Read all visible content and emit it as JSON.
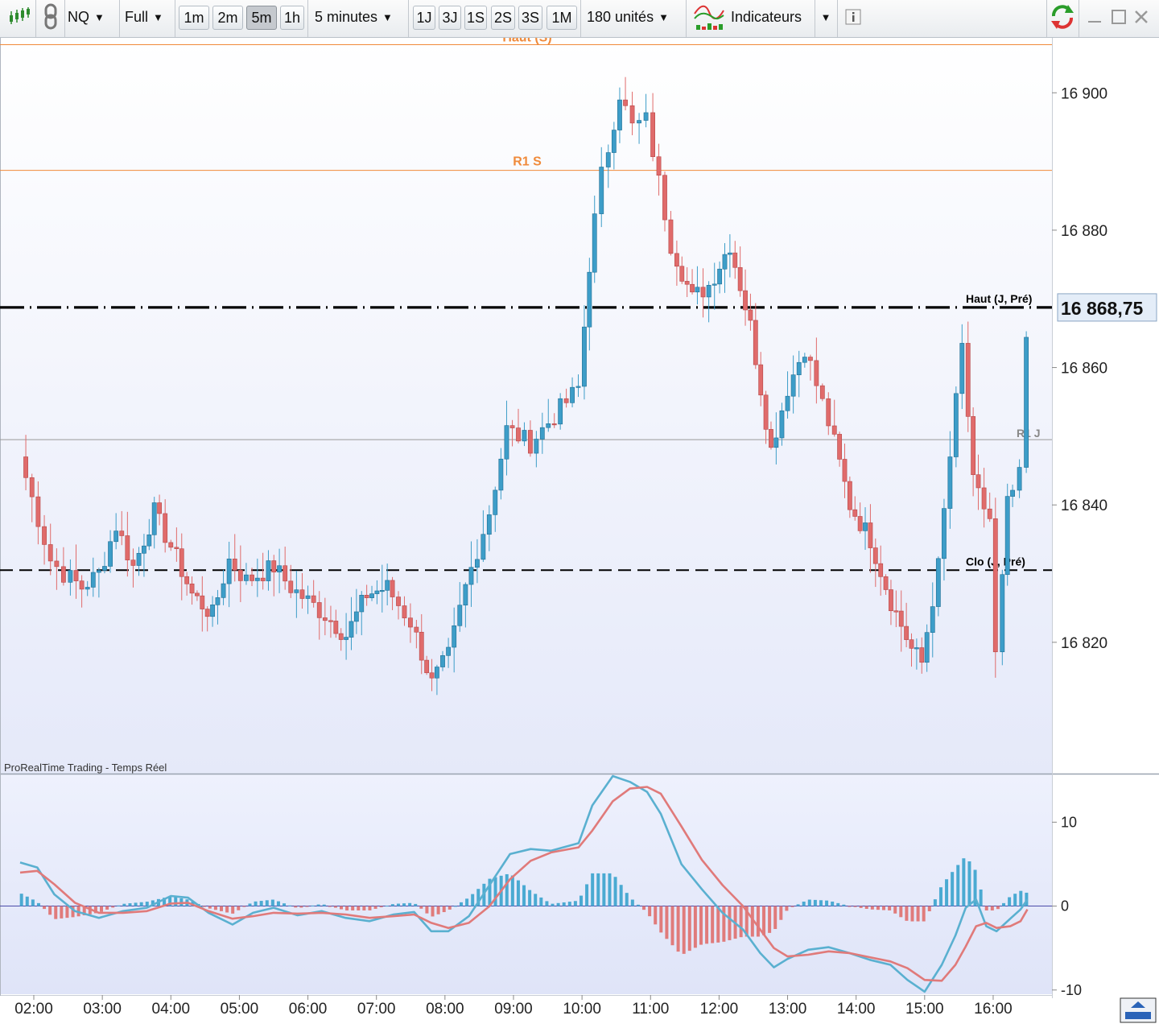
{
  "toolbar": {
    "symbol": "NQ",
    "mode": "Full",
    "timeframe_buttons": [
      "1m",
      "2m",
      "5m",
      "1h"
    ],
    "active_timeframe": "5m",
    "interval": "5 minutes",
    "range_buttons": [
      "1J",
      "3J",
      "1S",
      "2S",
      "3S",
      "1M"
    ],
    "units": "180 unités",
    "indicators": "Indicateurs"
  },
  "chart_data": [
    {
      "type": "candlestick",
      "watermark": "ProRealTime Trading - Temps Réel",
      "ylim": [
        16801,
        16908
      ],
      "y_ticks": [
        16820,
        16840,
        16860,
        16880,
        16900
      ],
      "y_tick_labels": [
        "16 820",
        "16 840",
        "16 860",
        "16 880",
        "16 900"
      ],
      "x_ticks": [
        2,
        3,
        4,
        5,
        6,
        7,
        8,
        9,
        10,
        11,
        12,
        13,
        14,
        15,
        16
      ],
      "x_tick_labels": [
        "02:00",
        "03:00",
        "04:00",
        "05:00",
        "06:00",
        "07:00",
        "08:00",
        "09:00",
        "10:00",
        "11:00",
        "12:00",
        "13:00",
        "14:00",
        "15:00",
        "16:00"
      ],
      "current_price": 16868.75,
      "current_price_label": "16 868,75",
      "levels": [
        {
          "label": "Haut (S)",
          "value": 16907,
          "color": "#f08a3a",
          "style": "solid"
        },
        {
          "label": "R1 S",
          "value": 16888.7,
          "color": "#f08a3a",
          "style": "solid"
        },
        {
          "label": "Haut (J, Pré)",
          "value": 16868.75,
          "color": "#000000",
          "style": "dashdot"
        },
        {
          "label": "R1 J",
          "value": 16849.5,
          "color": "#999999",
          "style": "solid"
        },
        {
          "label": "Clo (J, Pré)",
          "value": 16830.5,
          "color": "#000000",
          "style": "dashed"
        }
      ],
      "up_color": "#3d9dc8",
      "down_color": "#e06b6b",
      "path": [
        [
          1.8,
          16847
        ],
        [
          2.25,
          16832
        ],
        [
          2.45,
          16830
        ],
        [
          2.7,
          16828
        ],
        [
          2.95,
          16830
        ],
        [
          3.2,
          16837
        ],
        [
          3.45,
          16831
        ],
        [
          3.75,
          16839
        ],
        [
          4.0,
          16834
        ],
        [
          4.3,
          16827
        ],
        [
          4.6,
          16824
        ],
        [
          4.85,
          16832
        ],
        [
          5.1,
          16829
        ],
        [
          5.5,
          16831
        ],
        [
          5.75,
          16828
        ],
        [
          6.25,
          16824
        ],
        [
          6.55,
          16821
        ],
        [
          6.85,
          16827
        ],
        [
          7.15,
          16828
        ],
        [
          7.5,
          16823
        ],
        [
          7.8,
          16814
        ],
        [
          8.05,
          16818
        ],
        [
          8.3,
          16828
        ],
        [
          8.65,
          16839
        ],
        [
          8.9,
          16851
        ],
        [
          9.25,
          16849
        ],
        [
          9.6,
          16853
        ],
        [
          9.95,
          16857
        ],
        [
          10.1,
          16875
        ],
        [
          10.3,
          16888
        ],
        [
          10.55,
          16900
        ],
        [
          10.75,
          16895
        ],
        [
          10.95,
          16896
        ],
        [
          11.3,
          16878
        ],
        [
          11.6,
          16870
        ],
        [
          11.85,
          16872
        ],
        [
          12.15,
          16878
        ],
        [
          12.45,
          16866
        ],
        [
          12.75,
          16848
        ],
        [
          13.0,
          16857
        ],
        [
          13.25,
          16863
        ],
        [
          13.6,
          16852
        ],
        [
          13.9,
          16840
        ],
        [
          14.2,
          16835
        ],
        [
          14.5,
          16826
        ],
        [
          14.8,
          16819
        ],
        [
          14.95,
          16817
        ],
        [
          15.2,
          16831
        ],
        [
          15.55,
          16863
        ],
        [
          15.7,
          16843
        ],
        [
          15.95,
          16838
        ],
        [
          16.05,
          16818
        ],
        [
          16.2,
          16840
        ],
        [
          16.4,
          16844
        ],
        [
          16.5,
          16864
        ]
      ]
    },
    {
      "type": "line",
      "title": "",
      "ylim": [
        -10.5,
        15.5
      ],
      "y_ticks": [
        -10,
        0,
        10
      ],
      "y_tick_labels": [
        "-10",
        "0",
        "10"
      ],
      "series": [
        {
          "color": "#5ab0d0",
          "role": "macd",
          "points": [
            [
              1.8,
              5.2
            ],
            [
              2.05,
              4.6
            ],
            [
              2.3,
              1.4
            ],
            [
              2.6,
              -0.6
            ],
            [
              2.95,
              -1.4
            ],
            [
              3.3,
              -0.6
            ],
            [
              3.65,
              -0.2
            ],
            [
              4.0,
              1.2
            ],
            [
              4.25,
              1.0
            ],
            [
              4.55,
              -0.8
            ],
            [
              4.9,
              -2.2
            ],
            [
              5.2,
              -0.8
            ],
            [
              5.5,
              -0.2
            ],
            [
              5.85,
              -1.1
            ],
            [
              6.2,
              -0.6
            ],
            [
              6.55,
              -1.4
            ],
            [
              6.9,
              -1.8
            ],
            [
              7.25,
              -1.0
            ],
            [
              7.55,
              -0.7
            ],
            [
              7.8,
              -3.0
            ],
            [
              8.05,
              -3.0
            ],
            [
              8.35,
              -1.2
            ],
            [
              8.65,
              2.5
            ],
            [
              8.95,
              6.2
            ],
            [
              9.25,
              6.8
            ],
            [
              9.55,
              6.6
            ],
            [
              9.95,
              7.5
            ],
            [
              10.15,
              12.0
            ],
            [
              10.45,
              15.5
            ],
            [
              10.7,
              14.8
            ],
            [
              10.95,
              13.6
            ],
            [
              11.15,
              11.0
            ],
            [
              11.45,
              5.0
            ],
            [
              11.75,
              2.0
            ],
            [
              12.05,
              -0.8
            ],
            [
              12.35,
              -2.8
            ],
            [
              12.6,
              -5.6
            ],
            [
              12.8,
              -7.3
            ],
            [
              13.0,
              -6.3
            ],
            [
              13.3,
              -5.2
            ],
            [
              13.6,
              -4.9
            ],
            [
              13.9,
              -5.6
            ],
            [
              14.2,
              -6.4
            ],
            [
              14.5,
              -7.0
            ],
            [
              14.75,
              -8.8
            ],
            [
              15.0,
              -10.2
            ],
            [
              15.25,
              -7.0
            ],
            [
              15.45,
              -3.5
            ],
            [
              15.6,
              -0.2
            ],
            [
              15.75,
              0.8
            ],
            [
              15.9,
              -2.4
            ],
            [
              16.05,
              -3.0
            ],
            [
              16.25,
              -1.5
            ],
            [
              16.4,
              -0.4
            ],
            [
              16.5,
              0.8
            ]
          ]
        },
        {
          "color": "#e07a7a",
          "role": "signal",
          "points": [
            [
              1.8,
              4.0
            ],
            [
              2.05,
              4.2
            ],
            [
              2.3,
              2.6
            ],
            [
              2.6,
              0.4
            ],
            [
              2.95,
              -0.8
            ],
            [
              3.3,
              -0.8
            ],
            [
              3.65,
              -0.6
            ],
            [
              4.0,
              0.3
            ],
            [
              4.25,
              0.4
            ],
            [
              4.55,
              -0.6
            ],
            [
              4.9,
              -1.5
            ],
            [
              5.2,
              -1.2
            ],
            [
              5.5,
              -0.8
            ],
            [
              5.85,
              -0.9
            ],
            [
              6.2,
              -0.8
            ],
            [
              6.55,
              -1.0
            ],
            [
              6.9,
              -1.4
            ],
            [
              7.25,
              -1.2
            ],
            [
              7.55,
              -1.0
            ],
            [
              7.8,
              -2.0
            ],
            [
              8.05,
              -2.6
            ],
            [
              8.35,
              -2.0
            ],
            [
              8.65,
              0.0
            ],
            [
              8.95,
              3.2
            ],
            [
              9.25,
              5.4
            ],
            [
              9.55,
              6.4
            ],
            [
              9.95,
              7.0
            ],
            [
              10.15,
              9.0
            ],
            [
              10.45,
              12.5
            ],
            [
              10.7,
              14.0
            ],
            [
              10.95,
              14.2
            ],
            [
              11.15,
              13.4
            ],
            [
              11.45,
              9.5
            ],
            [
              11.75,
              5.5
            ],
            [
              12.05,
              2.5
            ],
            [
              12.35,
              0.0
            ],
            [
              12.6,
              -2.8
            ],
            [
              12.8,
              -5.0
            ],
            [
              13.0,
              -6.0
            ],
            [
              13.3,
              -5.8
            ],
            [
              13.6,
              -5.4
            ],
            [
              13.9,
              -5.6
            ],
            [
              14.2,
              -6.1
            ],
            [
              14.5,
              -6.6
            ],
            [
              14.75,
              -7.4
            ],
            [
              15.0,
              -8.8
            ],
            [
              15.25,
              -8.9
            ],
            [
              15.45,
              -7.0
            ],
            [
              15.6,
              -4.8
            ],
            [
              15.75,
              -2.4
            ],
            [
              15.9,
              -2.0
            ],
            [
              16.05,
              -2.6
            ],
            [
              16.25,
              -2.4
            ],
            [
              16.4,
              -1.8
            ],
            [
              16.5,
              -0.4
            ]
          ]
        }
      ]
    }
  ]
}
